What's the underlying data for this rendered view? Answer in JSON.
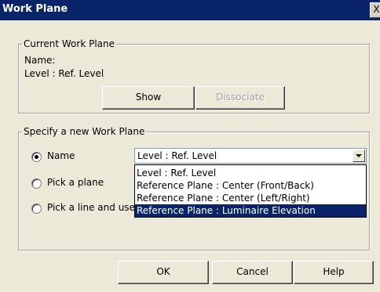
{
  "window": {
    "title": "Work Plane",
    "close_glyph": "X"
  },
  "current": {
    "legend": "Current Work Plane",
    "name_label": "Name:",
    "name_value": "Level : Ref. Level",
    "show_button": "Show",
    "dissociate_button": "Dissociate"
  },
  "specify": {
    "legend": "Specify a new Work Plane",
    "options": [
      {
        "label": "Name",
        "selected": true
      },
      {
        "label": "Pick a plane",
        "selected": false
      },
      {
        "label": "Pick a line and use",
        "selected": false
      }
    ],
    "combo_value": "Level : Ref. Level",
    "dropdown_items": [
      "Level : Ref. Level",
      "Reference Plane : Center (Front/Back)",
      "Reference Plane : Center (Left/Right)",
      "Reference Plane : Luminaire Elevation"
    ],
    "highlighted_index": 3
  },
  "footer": {
    "ok": "OK",
    "cancel": "Cancel",
    "help": "Help"
  },
  "colors": {
    "titlebar": "#0a246a",
    "dialog_bg": "#ece9d8",
    "highlight": "#0a246a"
  }
}
